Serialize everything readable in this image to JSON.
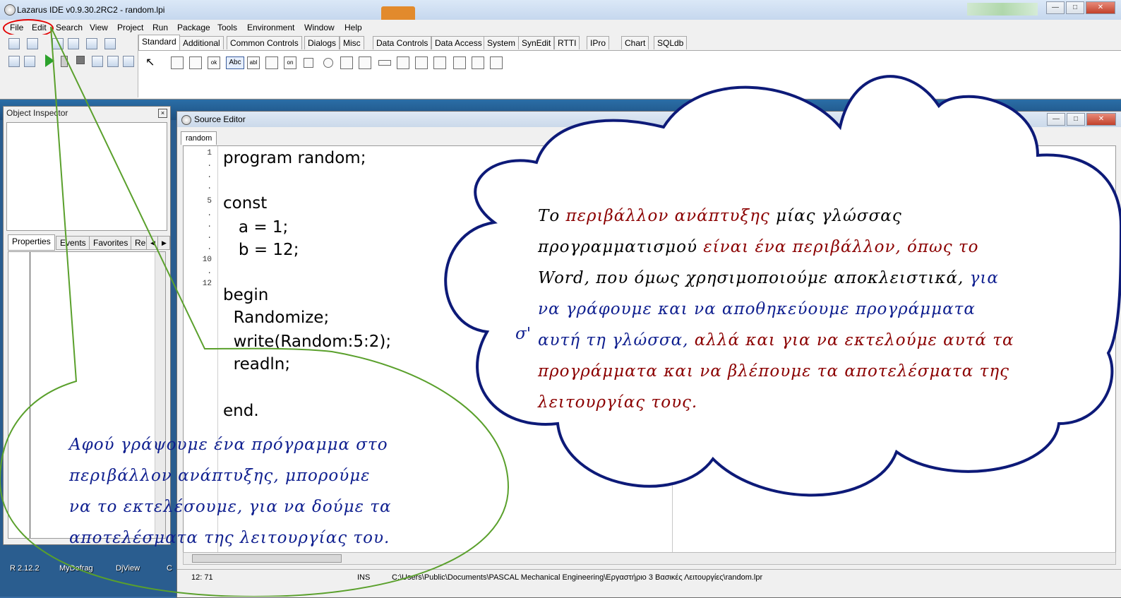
{
  "window": {
    "title": "Lazarus IDE v0.9.30.2RC2 - random.lpi"
  },
  "menu": [
    "File",
    "Edit",
    "Search",
    "View",
    "Project",
    "Run",
    "Package",
    "Tools",
    "Environment",
    "Window",
    "Help"
  ],
  "palette_tabs": [
    "Standard",
    "Additional",
    "Common Controls",
    "Dialogs",
    "Misc",
    "Data Controls",
    "Data Access",
    "System",
    "SynEdit",
    "RTTI",
    "IPro",
    "Chart",
    "SQLdb"
  ],
  "palette_icon_labels": {
    "ok": "ok",
    "abc": "Abc",
    "abl": "abl",
    "on": "on"
  },
  "object_inspector": {
    "title": "Object Inspector",
    "tabs": [
      "Properties",
      "Events",
      "Favorites",
      "Re"
    ]
  },
  "source_editor": {
    "title": "Source Editor",
    "tab": "random",
    "line_numbers": [
      "1",
      ".",
      ".",
      ".",
      "5",
      ".",
      ".",
      ".",
      ".",
      "10",
      ".",
      "12"
    ],
    "code": [
      "program random;",
      "",
      "const",
      "   a = 1;",
      "   b = 12;",
      "",
      "begin",
      "  Randomize;",
      "  write(Random:5:2);",
      "  readln;",
      "",
      "end."
    ],
    "status": {
      "position": "12: 71",
      "mode": "INS",
      "path": "C:\\Users\\Public\\Documents\\PASCAL Mechanical Engineering\\Εργαστήριο 3 Βασικές Λειτουργίες\\random.lpr"
    }
  },
  "desktop_icons": [
    "R 2.12.2",
    "MyDefrag",
    "DjView",
    "C"
  ],
  "cloud_note": {
    "prefix": "σ'",
    "lines": [
      [
        {
          "t": "Το ",
          "c": "k"
        },
        {
          "t": "περιβάλλον ανάπτυξης",
          "c": "r"
        },
        {
          "t": " μίας γλώσσας",
          "c": "k"
        }
      ],
      [
        {
          "t": "προγραμματισμού ",
          "c": "k"
        },
        {
          "t": "είναι ένα περιβάλλον, όπως το",
          "c": "r"
        }
      ],
      [
        {
          "t": "Word, που όμως χρησιμοποιούμε αποκλειστικά, ",
          "c": "k"
        },
        {
          "t": "για",
          "c": "b"
        }
      ],
      [
        {
          "t": "να γράφουμε και να αποθηκεύουμε προγράμματα",
          "c": "b"
        }
      ],
      [
        {
          "t": "αυτή τη γλώσσα, ",
          "c": "b"
        },
        {
          "t": "αλλά και για να εκτελούμε αυτά τα",
          "c": "r"
        }
      ],
      [
        {
          "t": "προγράμματα και να βλέπουμε τα αποτελέσματα της",
          "c": "r"
        }
      ],
      [
        {
          "t": "λειτουργίας τους.",
          "c": "r"
        }
      ]
    ]
  },
  "callout_note": {
    "lines": [
      "Αφού γράψουμε ένα πρόγραμμα στο",
      "περιβάλλον ανάπτυξης, μπορούμε",
      "να το εκτελέσουμε, για να δούμε τα",
      "αποτελέσματα της λειτουργίας του."
    ]
  },
  "colors": {
    "annotation_red": "#8b0000",
    "annotation_blue": "#0f1f8f",
    "cloud_outline": "#0d1a78",
    "callout_outline": "#5aa02c",
    "highlight_oval": "#e30000",
    "run_button": "#2ca22c"
  },
  "icons": {
    "run": "play-icon",
    "pause": "pause-icon",
    "stop": "stop-icon",
    "close": "close-icon",
    "minimize": "minimize-icon",
    "maximize": "maximize-icon"
  }
}
